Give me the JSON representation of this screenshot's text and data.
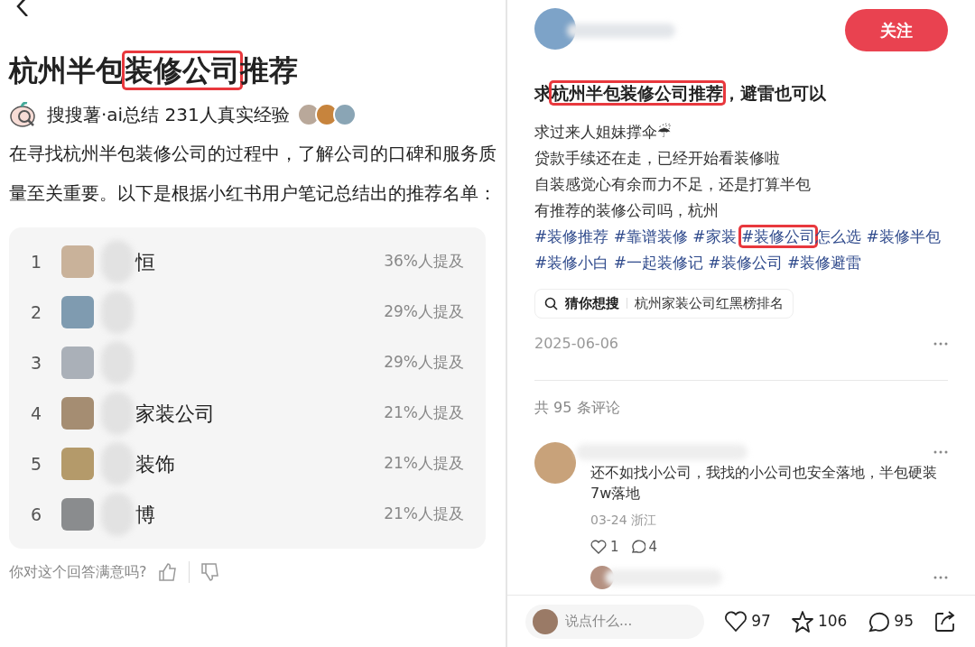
{
  "left": {
    "title": [
      {
        "text": "杭州半包",
        "highlighted": false
      },
      {
        "text": "装修公司",
        "highlighted": true
      },
      {
        "text": "推荐",
        "highlighted": false
      }
    ],
    "source": "搜搜薯·ai总结 231人真实经验",
    "intro": "在寻找杭州半包装修公司的过程中，了解公司的口碑和服务质量至关重要。以下是根据小红书用户笔记总结出的推荐名单：",
    "ranking": [
      {
        "rank": "1",
        "name": "恒",
        "mentions": "36%人提及"
      },
      {
        "rank": "2",
        "mentions": "29%人提及"
      },
      {
        "rank": "3",
        "mentions": "29%人提及"
      },
      {
        "rank": "4",
        "name": "家装公司",
        "mentions": "21%人提及"
      },
      {
        "rank": "5",
        "name": "装饰",
        "mentions": "21%人提及"
      },
      {
        "rank": "6",
        "name": "博",
        "mentions": "21%人提及"
      }
    ],
    "feedback": "你对这个回答满意吗?"
  },
  "right": {
    "follow_button": "关注",
    "title": [
      {
        "text": "求",
        "highlighted": false
      },
      {
        "text": "杭州半包装修公司推荐",
        "highlighted": true
      },
      {
        "text": "，避雷也可以",
        "highlighted": false
      }
    ],
    "body": [
      "求过来人姐妹撑伞☔",
      "贷款手续还在走，已经开始看装修啦",
      "自装感觉心有余而力不足，还是打算半包",
      "有推荐的装修公司吗，杭州"
    ],
    "hashtags": [
      {
        "text": "#装修推荐 #靠谱装修 #家装 ",
        "highlighted": false
      },
      {
        "text": "#装修公司",
        "highlighted": true
      },
      {
        "text": "怎么选 #装修半包 #装修小白 #一起装修记 #装修公司 #装修避雷",
        "highlighted": false
      }
    ],
    "search_label": "猜你想搜",
    "search_query": "杭州家装公司红黑榜排名",
    "date": "2025-06-06",
    "comment_count": "共 95 条评论",
    "comments": [
      {
        "text": "还不如找小公司，我找的小公司也安全落地，半包硬装7w落地",
        "meta": "03-24 浙江",
        "likes": "1",
        "replies": "4"
      }
    ],
    "input_placeholder": "说点什么...",
    "likes": "97",
    "stars": "106",
    "comments_total": "95"
  }
}
